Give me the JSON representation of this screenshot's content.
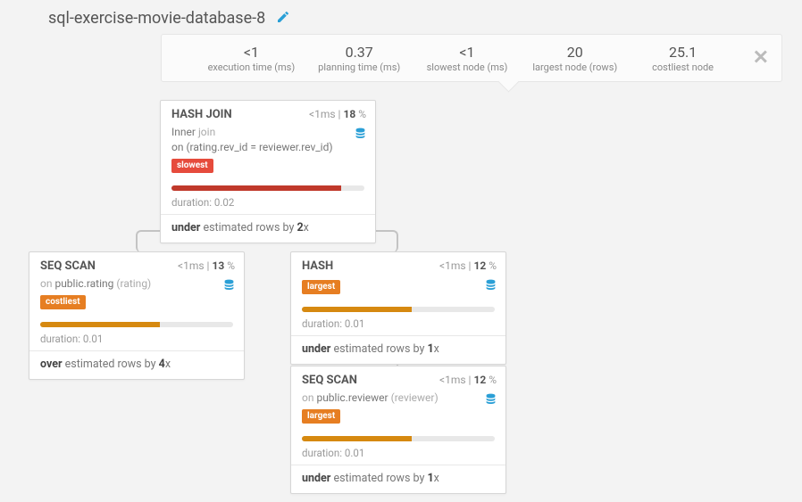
{
  "title": "sql-exercise-movie-database-8",
  "summary": [
    {
      "value": "<1",
      "label": "execution time (ms)"
    },
    {
      "value": "0.37",
      "label": "planning time (ms)"
    },
    {
      "value": "<1",
      "label": "slowest node (ms)"
    },
    {
      "value": "20",
      "label": "largest node (rows)"
    },
    {
      "value": "25.1",
      "label": "costliest node"
    }
  ],
  "nodes": {
    "hashjoin": {
      "title": "HASH JOIN",
      "time": "<1",
      "pct": "18",
      "desc_lead": "Inner ",
      "desc_grey": "join",
      "desc_line2": "on (rating.rev_id = reviewer.rev_id)",
      "tag": "slowest",
      "tag_class": "tag-red",
      "bar_class": "bar-red",
      "bar_pct": 88,
      "duration": "duration: 0.02",
      "est_lead": "under",
      "est_rest": " estimated rows by ",
      "est_factor": "2",
      "est_suffix": "x"
    },
    "seqscan1": {
      "title": "SEQ SCAN",
      "time": "<1",
      "pct": "13",
      "desc_lead": "on ",
      "desc_main": "public.rating ",
      "desc_grey": "(rating)",
      "tag": "costliest",
      "tag_class": "tag-orange",
      "bar_class": "bar-orange",
      "bar_pct": 62,
      "duration": "duration: 0.01",
      "est_lead": "over",
      "est_rest": " estimated rows by ",
      "est_factor": "4",
      "est_suffix": "x"
    },
    "hash": {
      "title": "HASH",
      "time": "<1",
      "pct": "12",
      "tag": "largest",
      "tag_class": "tag-orange",
      "bar_class": "bar-orange",
      "bar_pct": 57,
      "duration": "duration: 0.01",
      "est_lead": "under",
      "est_rest": " estimated rows by ",
      "est_factor": "1",
      "est_suffix": "x"
    },
    "seqscan2": {
      "title": "SEQ SCAN",
      "time": "<1",
      "pct": "12",
      "desc_lead": "on ",
      "desc_main": "public.reviewer ",
      "desc_grey": "(reviewer)",
      "tag": "largest",
      "tag_class": "tag-orange",
      "bar_class": "bar-orange",
      "bar_pct": 57,
      "duration": "duration: 0.01",
      "est_lead": "under",
      "est_rest": " estimated rows by ",
      "est_factor": "1",
      "est_suffix": "x"
    }
  },
  "labels": {
    "ms": "ms",
    "pipe": " | ",
    "pct": " %"
  }
}
